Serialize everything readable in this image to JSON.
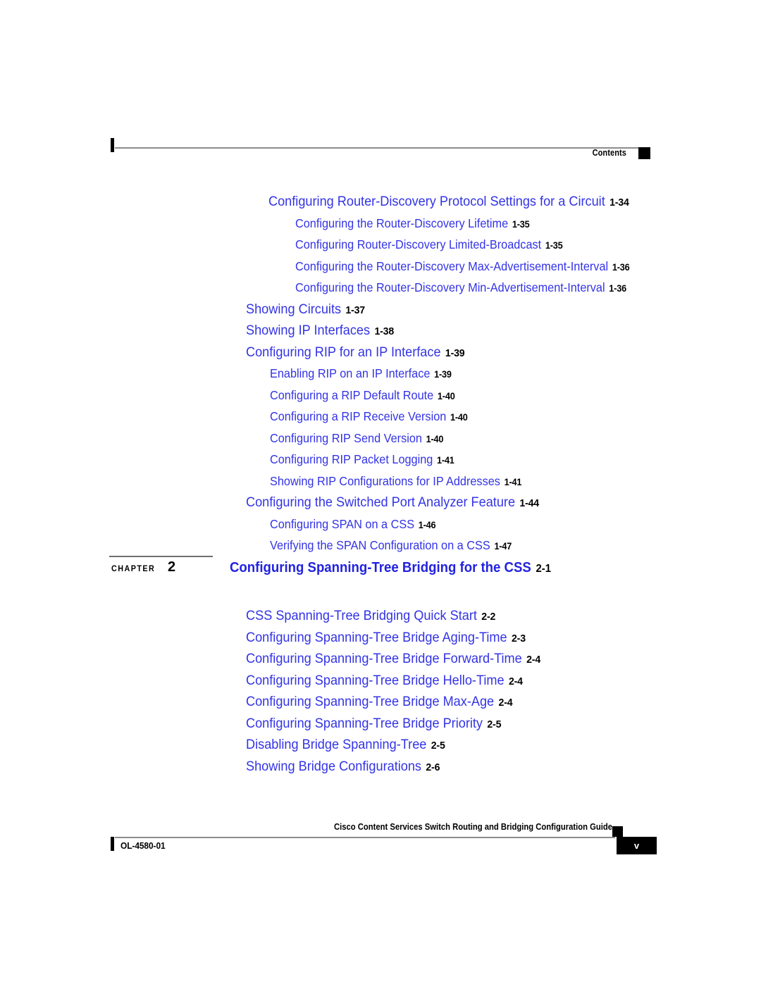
{
  "header": {
    "label": "Contents"
  },
  "toc": {
    "section_a": [
      {
        "level": 1,
        "title": "Configuring Router-Discovery Protocol Settings for a Circuit",
        "page": "1-34"
      },
      {
        "level": 2,
        "title": "Configuring the Router-Discovery Lifetime",
        "page": "1-35"
      },
      {
        "level": 2,
        "title": "Configuring Router-Discovery Limited-Broadcast",
        "page": "1-35"
      },
      {
        "level": 2,
        "title": "Configuring the Router-Discovery Max-Advertisement-Interval",
        "page": "1-36"
      },
      {
        "level": 2,
        "title": "Configuring the Router-Discovery Min-Advertisement-Interval",
        "page": "1-36"
      }
    ],
    "section_b": [
      {
        "level": 1,
        "title": "Showing Circuits",
        "page": "1-37"
      },
      {
        "level": 1,
        "title": "Showing IP Interfaces",
        "page": "1-38"
      }
    ],
    "section_c": [
      {
        "level": 1,
        "title": "Configuring RIP for an IP Interface",
        "page": "1-39"
      },
      {
        "level": 2,
        "title": "Enabling RIP on an IP Interface",
        "page": "1-39"
      },
      {
        "level": 2,
        "title": "Configuring a RIP Default Route",
        "page": "1-40"
      },
      {
        "level": 2,
        "title": "Configuring a RIP Receive Version",
        "page": "1-40"
      },
      {
        "level": 2,
        "title": "Configuring RIP Send Version",
        "page": "1-40"
      },
      {
        "level": 2,
        "title": "Configuring RIP Packet Logging",
        "page": "1-41"
      },
      {
        "level": 2,
        "title": "Showing RIP Configurations for IP Addresses",
        "page": "1-41"
      }
    ],
    "section_d": [
      {
        "level": 1,
        "title": "Configuring the Switched Port Analyzer Feature",
        "page": "1-44"
      },
      {
        "level": 2,
        "title": "Configuring SPAN on a CSS",
        "page": "1-46"
      },
      {
        "level": 2,
        "title": "Verifying the SPAN Configuration on a CSS",
        "page": "1-47"
      }
    ]
  },
  "chapter": {
    "tag": "CHAPTER",
    "number": "2",
    "title": "Configuring Spanning-Tree Bridging for the CSS",
    "page": "2-1",
    "entries": [
      {
        "level": 1,
        "title": "CSS Spanning-Tree Bridging Quick Start",
        "page": "2-2"
      },
      {
        "level": 1,
        "title": "Configuring Spanning-Tree Bridge Aging-Time",
        "page": "2-3"
      },
      {
        "level": 1,
        "title": "Configuring Spanning-Tree Bridge Forward-Time",
        "page": "2-4"
      },
      {
        "level": 1,
        "title": "Configuring Spanning-Tree Bridge Hello-Time",
        "page": "2-4"
      },
      {
        "level": 1,
        "title": "Configuring Spanning-Tree Bridge Max-Age",
        "page": "2-4"
      },
      {
        "level": 1,
        "title": "Configuring Spanning-Tree Bridge Priority",
        "page": "2-5"
      },
      {
        "level": 1,
        "title": "Disabling Bridge Spanning-Tree",
        "page": "2-5"
      },
      {
        "level": 1,
        "title": "Showing Bridge Configurations",
        "page": "2-6"
      }
    ]
  },
  "footer": {
    "guide_title": "Cisco Content Services Switch Routing and Bridging Configuration Guide",
    "doc_id": "OL-4580-01",
    "page_number": "v"
  },
  "colors": {
    "link_blue": "#3333e6",
    "heading_blue": "#2222e0",
    "rule_gray": "#8c8c8c",
    "text_black": "#000000"
  }
}
